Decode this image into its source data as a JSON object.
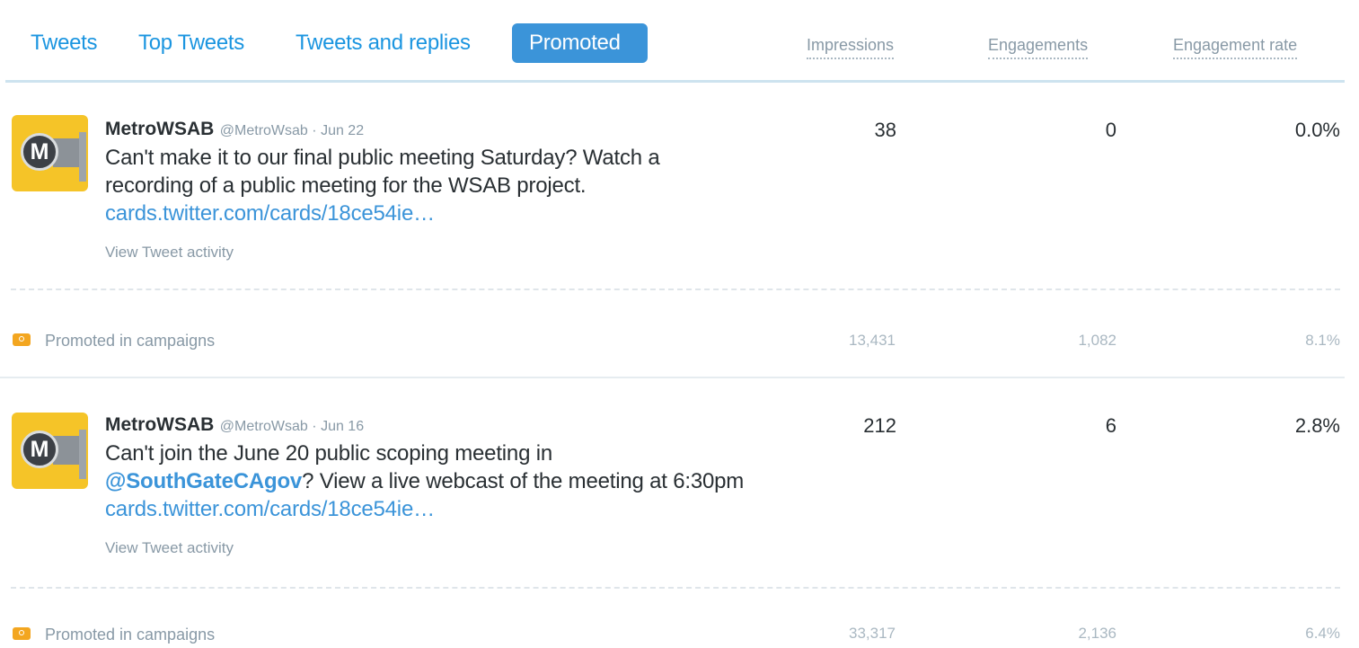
{
  "tabs": [
    {
      "label": "Tweets"
    },
    {
      "label": "Top Tweets"
    },
    {
      "label": "Tweets and replies"
    },
    {
      "label": "Promoted",
      "active": true
    }
  ],
  "columns": {
    "impressions": "Impressions",
    "engagements": "Engagements",
    "engagement_rate": "Engagement rate"
  },
  "tweets": [
    {
      "name": "MetroWSAB",
      "handle": "@MetroWsab",
      "separator": "·",
      "date": "Jun 22",
      "avatar_letter": "M",
      "text_before": "Can't make it to our final public meeting Saturday? Watch a recording of a public meeting for the WSAB project.",
      "mention": "",
      "text_after": "",
      "link": "cards.twitter.com/cards/18ce54ie…",
      "activity_label": "View Tweet activity",
      "impressions": "38",
      "engagements": "0",
      "engagement_rate": "0.0%",
      "promoted": {
        "label": "Promoted in campaigns",
        "impressions": "13,431",
        "engagements": "1,082",
        "engagement_rate": "8.1%"
      }
    },
    {
      "name": "MetroWSAB",
      "handle": "@MetroWsab",
      "separator": "·",
      "date": "Jun 16",
      "avatar_letter": "M",
      "text_before": "Can't join the June 20 public scoping meeting in",
      "mention": "@SouthGateCAgov",
      "text_after": "? View a live webcast of the meeting at 6:30pm",
      "link": "cards.twitter.com/cards/18ce54ie…",
      "activity_label": "View Tweet activity",
      "impressions": "212",
      "engagements": "6",
      "engagement_rate": "2.8%",
      "promoted": {
        "label": "Promoted in campaigns",
        "impressions": "33,317",
        "engagements": "2,136",
        "engagement_rate": "6.4%"
      }
    }
  ],
  "colors": {
    "accent": "#3b94d9",
    "tab_link": "#1b95e0",
    "muted": "#8899a6",
    "avatar_bg": "#f5c428",
    "promo_icon": "#f3a620"
  }
}
